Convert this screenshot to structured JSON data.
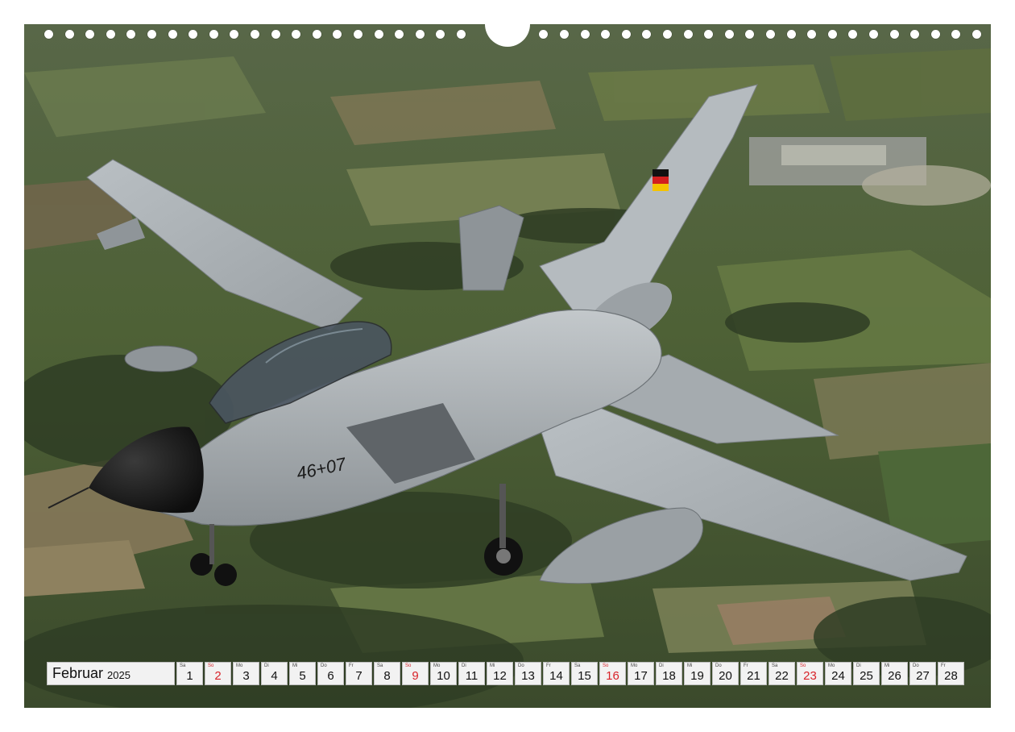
{
  "calendar": {
    "month": "Februar",
    "year": "2025",
    "days": [
      {
        "wd": "Sa",
        "num": "1",
        "sun": false
      },
      {
        "wd": "So",
        "num": "2",
        "sun": true
      },
      {
        "wd": "Mo",
        "num": "3",
        "sun": false
      },
      {
        "wd": "Di",
        "num": "4",
        "sun": false
      },
      {
        "wd": "Mi",
        "num": "5",
        "sun": false
      },
      {
        "wd": "Do",
        "num": "6",
        "sun": false
      },
      {
        "wd": "Fr",
        "num": "7",
        "sun": false
      },
      {
        "wd": "Sa",
        "num": "8",
        "sun": false
      },
      {
        "wd": "So",
        "num": "9",
        "sun": true
      },
      {
        "wd": "Mo",
        "num": "10",
        "sun": false
      },
      {
        "wd": "Di",
        "num": "11",
        "sun": false
      },
      {
        "wd": "Mi",
        "num": "12",
        "sun": false
      },
      {
        "wd": "Do",
        "num": "13",
        "sun": false
      },
      {
        "wd": "Fr",
        "num": "14",
        "sun": false
      },
      {
        "wd": "Sa",
        "num": "15",
        "sun": false
      },
      {
        "wd": "So",
        "num": "16",
        "sun": true
      },
      {
        "wd": "Mo",
        "num": "17",
        "sun": false
      },
      {
        "wd": "Di",
        "num": "18",
        "sun": false
      },
      {
        "wd": "Mi",
        "num": "19",
        "sun": false
      },
      {
        "wd": "Do",
        "num": "20",
        "sun": false
      },
      {
        "wd": "Fr",
        "num": "21",
        "sun": false
      },
      {
        "wd": "Sa",
        "num": "22",
        "sun": false
      },
      {
        "wd": "So",
        "num": "23",
        "sun": true
      },
      {
        "wd": "Mo",
        "num": "24",
        "sun": false
      },
      {
        "wd": "Di",
        "num": "25",
        "sun": false
      },
      {
        "wd": "Mi",
        "num": "26",
        "sun": false
      },
      {
        "wd": "Do",
        "num": "27",
        "sun": false
      },
      {
        "wd": "Fr",
        "num": "28",
        "sun": false
      }
    ]
  },
  "aircraft": {
    "serial": "46+07"
  },
  "colors": {
    "sunday": "#d8232a",
    "aircraft_gray": "#a7adb1",
    "ground_green": "#5a6b40"
  }
}
